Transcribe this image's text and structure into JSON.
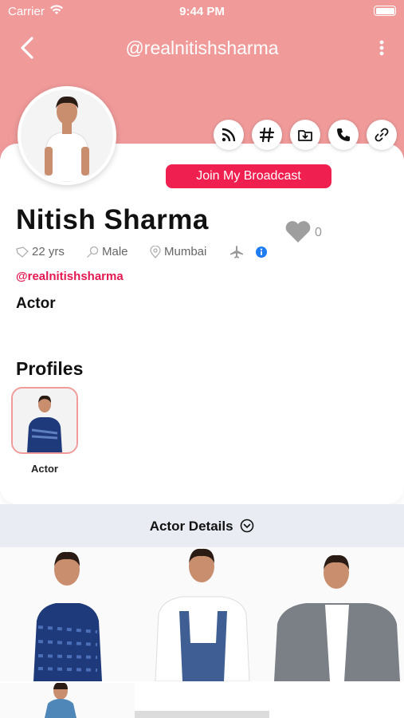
{
  "status_bar": {
    "carrier": "Carrier",
    "time": "9:44 PM"
  },
  "nav": {
    "title": "@realnitishsharma"
  },
  "profile": {
    "name": "Nitish Sharma",
    "likes": "0",
    "age": "22 yrs",
    "gender": "Male",
    "location": "Mumbai",
    "handle": "@realnitishsharma",
    "role": "Actor"
  },
  "actions": [
    "rss-icon",
    "hashtag-icon",
    "download-folder-icon",
    "phone-icon",
    "link-icon"
  ],
  "broadcast_label": "Join My Broadcast",
  "profiles": {
    "title": "Profiles",
    "items": [
      {
        "label": "Actor"
      }
    ]
  },
  "details_label": "Actor Details",
  "colors": {
    "header": "#f09a9a",
    "accent": "#ef1f4f",
    "handle": "#e3174f",
    "details_bg": "#e9ecf2",
    "info": "#1f7cf2"
  }
}
